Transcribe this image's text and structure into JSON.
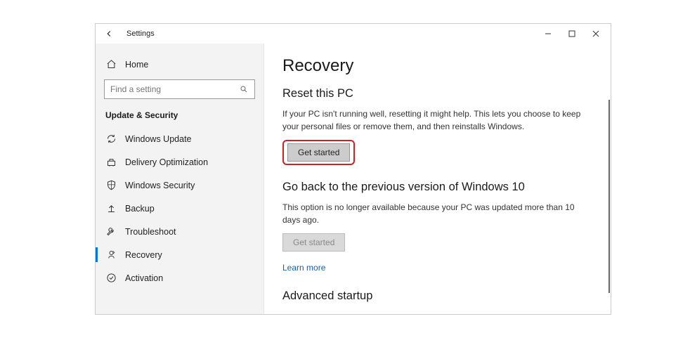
{
  "window": {
    "title": "Settings"
  },
  "sidebar": {
    "home_label": "Home",
    "search_placeholder": "Find a setting",
    "category": "Update & Security",
    "items": [
      {
        "label": "Windows Update"
      },
      {
        "label": "Delivery Optimization"
      },
      {
        "label": "Windows Security"
      },
      {
        "label": "Backup"
      },
      {
        "label": "Troubleshoot"
      },
      {
        "label": "Recovery"
      },
      {
        "label": "Activation"
      }
    ]
  },
  "main": {
    "page_title": "Recovery",
    "reset": {
      "title": "Reset this PC",
      "desc": "If your PC isn't running well, resetting it might help. This lets you choose to keep your personal files or remove them, and then reinstalls Windows.",
      "button": "Get started"
    },
    "goback": {
      "title": "Go back to the previous version of Windows 10",
      "desc": "This option is no longer available because your PC was updated more than 10 days ago.",
      "button": "Get started",
      "learn_more": "Learn more"
    },
    "advanced": {
      "title": "Advanced startup"
    }
  }
}
